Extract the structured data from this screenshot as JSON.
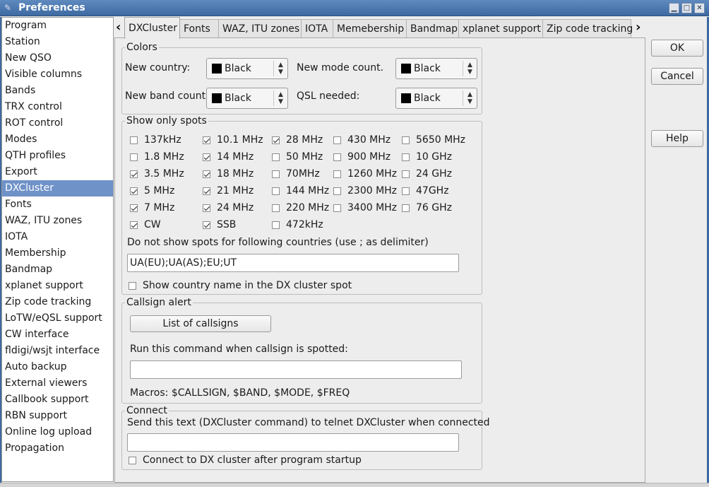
{
  "window": {
    "title": "Preferences",
    "min": "▁",
    "max": "□",
    "close": "✕"
  },
  "sidebar": {
    "items": [
      "Program",
      "Station",
      "New QSO",
      "Visible columns",
      "Bands",
      "TRX control",
      "ROT control",
      "Modes",
      "QTH profiles",
      "Export",
      "DXCluster",
      "Fonts",
      "WAZ, ITU zones",
      "IOTA",
      "Membership",
      "Bandmap",
      "xplanet support",
      "Zip code tracking",
      "LoTW/eQSL support",
      "CW interface",
      "fldigi/wsjt interface",
      "Auto backup",
      "External viewers",
      "Callbook support",
      "RBN support",
      "Online log upload",
      "Propagation"
    ],
    "selected": "DXCluster"
  },
  "tabs": {
    "items": [
      "DXCluster",
      "Fonts",
      "WAZ, ITU zones",
      "IOTA",
      "Memebership",
      "Bandmap",
      "xplanet support",
      "Zip code tracking"
    ],
    "active": "DXCluster",
    "left_arrow": "‹",
    "right_arrow": "›"
  },
  "colors": {
    "legend": "Colors",
    "new_country_label": "New country:",
    "new_country_value": "Black",
    "new_mode_label": "New mode count.",
    "new_mode_value": "Black",
    "new_band_label": "New band count.",
    "new_band_value": "Black",
    "qsl_label": "QSL needed:",
    "qsl_value": "Black"
  },
  "spots": {
    "legend": "Show only spots",
    "columns": [
      [
        {
          "label": "137kHz",
          "checked": false
        },
        {
          "label": "1.8 MHz",
          "checked": false
        },
        {
          "label": "3.5 MHz",
          "checked": true
        },
        {
          "label": "5 MHz",
          "checked": true
        },
        {
          "label": "7 MHz",
          "checked": true
        },
        {
          "label": "CW",
          "checked": true
        }
      ],
      [
        {
          "label": "10.1 MHz",
          "checked": true
        },
        {
          "label": "14 MHz",
          "checked": true
        },
        {
          "label": "18 MHz",
          "checked": true
        },
        {
          "label": "21 MHz",
          "checked": true
        },
        {
          "label": "24 MHz",
          "checked": true
        },
        {
          "label": "SSB",
          "checked": true
        }
      ],
      [
        {
          "label": "28 MHz",
          "checked": true
        },
        {
          "label": "50 MHz",
          "checked": false
        },
        {
          "label": "70MHz",
          "checked": false
        },
        {
          "label": "144 MHz",
          "checked": false
        },
        {
          "label": "220 MHz",
          "checked": false
        },
        {
          "label": "472kHz",
          "checked": false
        }
      ],
      [
        {
          "label": "430 MHz",
          "checked": false
        },
        {
          "label": "900 MHz",
          "checked": false
        },
        {
          "label": "1260 MHz",
          "checked": false
        },
        {
          "label": "2300 MHz",
          "checked": false
        },
        {
          "label": "3400 MHz",
          "checked": false
        }
      ],
      [
        {
          "label": "5650 MHz",
          "checked": false
        },
        {
          "label": "10 GHz",
          "checked": false
        },
        {
          "label": "24 GHz",
          "checked": false
        },
        {
          "label": "47GHz",
          "checked": false
        },
        {
          "label": "76 GHz",
          "checked": false
        }
      ]
    ],
    "exclude_label": "Do not show spots for following countries (use ; as delimiter)",
    "exclude_value": "UA(EU);UA(AS);EU;UT",
    "show_country_label": "Show country name in the DX cluster spot",
    "show_country_checked": false
  },
  "alert": {
    "legend": "Callsign alert",
    "list_button": "List of callsigns",
    "command_label": "Run this command when callsign is spotted:",
    "command_value": "",
    "macros": "Macros: $CALLSIGN, $BAND, $MODE, $FREQ"
  },
  "connect": {
    "legend": "Connect",
    "send_label": "Send this text (DXCluster command) to telnet DXCluster when connected",
    "send_value": "",
    "auto_label": "Connect to DX cluster after program startup",
    "auto_checked": false
  },
  "buttons": {
    "ok": "OK",
    "cancel": "Cancel",
    "help": "Help"
  }
}
